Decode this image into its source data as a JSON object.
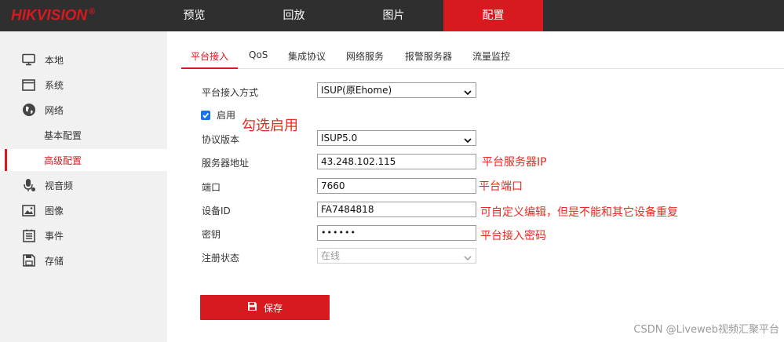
{
  "brand": {
    "logo": "HIKVISION",
    "reg": "®"
  },
  "nav": {
    "items": [
      {
        "label": "预览"
      },
      {
        "label": "回放"
      },
      {
        "label": "图片"
      },
      {
        "label": "配置"
      }
    ],
    "active": "配置"
  },
  "sidebar": {
    "items": [
      {
        "label": "本地",
        "icon": "monitor-icon"
      },
      {
        "label": "系统",
        "icon": "window-icon"
      },
      {
        "label": "网络",
        "icon": "globe-icon"
      },
      {
        "label": "基本配置"
      },
      {
        "label": "高级配置"
      },
      {
        "label": "视音频",
        "icon": "mic-icon"
      },
      {
        "label": "图像",
        "icon": "image-icon"
      },
      {
        "label": "事件",
        "icon": "list-icon"
      },
      {
        "label": "存储",
        "icon": "save-disk-icon"
      }
    ],
    "active": "高级配置"
  },
  "tabs": {
    "items": [
      {
        "label": "平台接入"
      },
      {
        "label": "QoS"
      },
      {
        "label": "集成协议"
      },
      {
        "label": "网络服务"
      },
      {
        "label": "报警服务器"
      },
      {
        "label": "流量监控"
      }
    ],
    "active": "平台接入"
  },
  "form": {
    "access_mode": {
      "label": "平台接入方式",
      "value": "ISUP(原Ehome)"
    },
    "enable": {
      "label": "启用",
      "checked": true
    },
    "protocol_version": {
      "label": "协议版本",
      "value": "ISUP5.0"
    },
    "server_address": {
      "label": "服务器地址",
      "value": "43.248.102.115"
    },
    "port": {
      "label": "端口",
      "value": "7660"
    },
    "device_id": {
      "label": "设备ID",
      "value": "FA7484818"
    },
    "key": {
      "label": "密钥",
      "value": "••••••"
    },
    "register_status": {
      "label": "注册状态",
      "value": "在线"
    },
    "save_label": "保存"
  },
  "annotations": {
    "enable": "勾选启用",
    "server": "平台服务器IP",
    "port": "平台端口",
    "device_id": "可自定义编辑，但是不能和其它设备重复",
    "key": "平台接入密码"
  },
  "watermark": "CSDN @Liveweb视频汇聚平台",
  "colors": {
    "accent": "#d71920",
    "topbar": "#2f2f2f",
    "sidebar": "#f1f1f1",
    "annotation": "#e42a1f",
    "checkbox": "#1a73e8"
  }
}
